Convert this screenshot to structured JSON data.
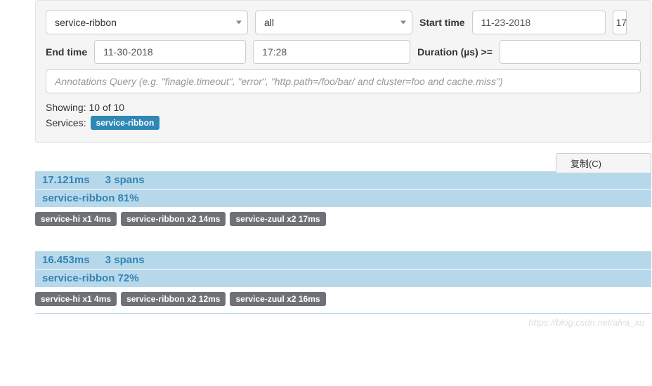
{
  "filters": {
    "service_select": "service-ribbon",
    "span_select": "all",
    "start_time_label": "Start time",
    "start_time_value": "11-23-2018",
    "start_time_extra": "17",
    "end_time_label": "End time",
    "end_time_value": "11-30-2018",
    "end_time_time": "17:28",
    "duration_label": "Duration (µs) >=",
    "duration_value": "",
    "annotations_placeholder": "Annotations Query (e.g. \"finagle.timeout\", \"error\", \"http.path=/foo/bar/ and cluster=foo and cache.miss\")"
  },
  "summary": {
    "showing": "Showing: 10 of 10",
    "services_label": "Services:",
    "services_badge": "service-ribbon"
  },
  "copy_tab": "复制(C)",
  "traces": [
    {
      "duration": "17.121ms",
      "spans": "3 spans",
      "service_line": "service-ribbon 81%",
      "tags": [
        "service-hi x1 4ms",
        "service-ribbon x2 14ms",
        "service-zuul x2 17ms"
      ]
    },
    {
      "duration": "16.453ms",
      "spans": "3 spans",
      "service_line": "service-ribbon 72%",
      "tags": [
        "service-hi x1 4ms",
        "service-ribbon x2 12ms",
        "service-zuul x2 16ms"
      ]
    }
  ],
  "watermark": "https://blog.csdn.net/alva_xu"
}
